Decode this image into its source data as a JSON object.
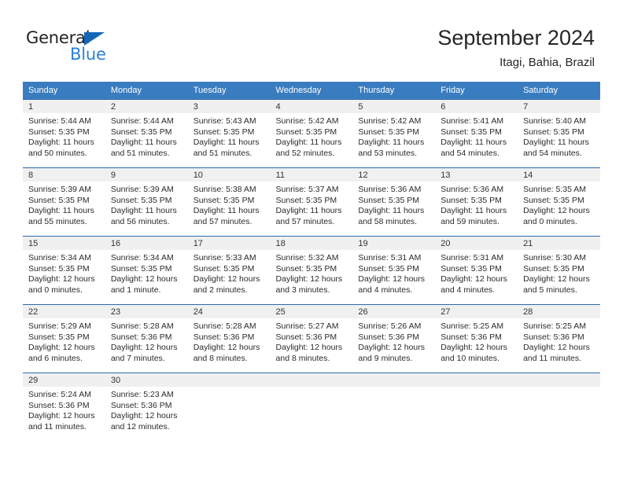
{
  "brand": {
    "name_dark": "General",
    "name_blue": "Blue",
    "color_dark": "#231f20",
    "color_blue": "#2a81d4",
    "triangle_color": "#1565b8"
  },
  "header": {
    "title": "September 2024",
    "subtitle": "Itagi, Bahia, Brazil"
  },
  "theme": {
    "header_bg": "#3a7cc0",
    "row_divider": "#2c6cb0",
    "daynum_bg": "#f0f0f0"
  },
  "calendar": {
    "weekday_headers": [
      "Sunday",
      "Monday",
      "Tuesday",
      "Wednesday",
      "Thursday",
      "Friday",
      "Saturday"
    ],
    "weeks": [
      [
        {
          "day": "1",
          "sunrise": "Sunrise: 5:44 AM",
          "sunset": "Sunset: 5:35 PM",
          "daylight_1": "Daylight: 11 hours",
          "daylight_2": "and 50 minutes."
        },
        {
          "day": "2",
          "sunrise": "Sunrise: 5:44 AM",
          "sunset": "Sunset: 5:35 PM",
          "daylight_1": "Daylight: 11 hours",
          "daylight_2": "and 51 minutes."
        },
        {
          "day": "3",
          "sunrise": "Sunrise: 5:43 AM",
          "sunset": "Sunset: 5:35 PM",
          "daylight_1": "Daylight: 11 hours",
          "daylight_2": "and 51 minutes."
        },
        {
          "day": "4",
          "sunrise": "Sunrise: 5:42 AM",
          "sunset": "Sunset: 5:35 PM",
          "daylight_1": "Daylight: 11 hours",
          "daylight_2": "and 52 minutes."
        },
        {
          "day": "5",
          "sunrise": "Sunrise: 5:42 AM",
          "sunset": "Sunset: 5:35 PM",
          "daylight_1": "Daylight: 11 hours",
          "daylight_2": "and 53 minutes."
        },
        {
          "day": "6",
          "sunrise": "Sunrise: 5:41 AM",
          "sunset": "Sunset: 5:35 PM",
          "daylight_1": "Daylight: 11 hours",
          "daylight_2": "and 54 minutes."
        },
        {
          "day": "7",
          "sunrise": "Sunrise: 5:40 AM",
          "sunset": "Sunset: 5:35 PM",
          "daylight_1": "Daylight: 11 hours",
          "daylight_2": "and 54 minutes."
        }
      ],
      [
        {
          "day": "8",
          "sunrise": "Sunrise: 5:39 AM",
          "sunset": "Sunset: 5:35 PM",
          "daylight_1": "Daylight: 11 hours",
          "daylight_2": "and 55 minutes."
        },
        {
          "day": "9",
          "sunrise": "Sunrise: 5:39 AM",
          "sunset": "Sunset: 5:35 PM",
          "daylight_1": "Daylight: 11 hours",
          "daylight_2": "and 56 minutes."
        },
        {
          "day": "10",
          "sunrise": "Sunrise: 5:38 AM",
          "sunset": "Sunset: 5:35 PM",
          "daylight_1": "Daylight: 11 hours",
          "daylight_2": "and 57 minutes."
        },
        {
          "day": "11",
          "sunrise": "Sunrise: 5:37 AM",
          "sunset": "Sunset: 5:35 PM",
          "daylight_1": "Daylight: 11 hours",
          "daylight_2": "and 57 minutes."
        },
        {
          "day": "12",
          "sunrise": "Sunrise: 5:36 AM",
          "sunset": "Sunset: 5:35 PM",
          "daylight_1": "Daylight: 11 hours",
          "daylight_2": "and 58 minutes."
        },
        {
          "day": "13",
          "sunrise": "Sunrise: 5:36 AM",
          "sunset": "Sunset: 5:35 PM",
          "daylight_1": "Daylight: 11 hours",
          "daylight_2": "and 59 minutes."
        },
        {
          "day": "14",
          "sunrise": "Sunrise: 5:35 AM",
          "sunset": "Sunset: 5:35 PM",
          "daylight_1": "Daylight: 12 hours",
          "daylight_2": "and 0 minutes."
        }
      ],
      [
        {
          "day": "15",
          "sunrise": "Sunrise: 5:34 AM",
          "sunset": "Sunset: 5:35 PM",
          "daylight_1": "Daylight: 12 hours",
          "daylight_2": "and 0 minutes."
        },
        {
          "day": "16",
          "sunrise": "Sunrise: 5:34 AM",
          "sunset": "Sunset: 5:35 PM",
          "daylight_1": "Daylight: 12 hours",
          "daylight_2": "and 1 minute."
        },
        {
          "day": "17",
          "sunrise": "Sunrise: 5:33 AM",
          "sunset": "Sunset: 5:35 PM",
          "daylight_1": "Daylight: 12 hours",
          "daylight_2": "and 2 minutes."
        },
        {
          "day": "18",
          "sunrise": "Sunrise: 5:32 AM",
          "sunset": "Sunset: 5:35 PM",
          "daylight_1": "Daylight: 12 hours",
          "daylight_2": "and 3 minutes."
        },
        {
          "day": "19",
          "sunrise": "Sunrise: 5:31 AM",
          "sunset": "Sunset: 5:35 PM",
          "daylight_1": "Daylight: 12 hours",
          "daylight_2": "and 4 minutes."
        },
        {
          "day": "20",
          "sunrise": "Sunrise: 5:31 AM",
          "sunset": "Sunset: 5:35 PM",
          "daylight_1": "Daylight: 12 hours",
          "daylight_2": "and 4 minutes."
        },
        {
          "day": "21",
          "sunrise": "Sunrise: 5:30 AM",
          "sunset": "Sunset: 5:35 PM",
          "daylight_1": "Daylight: 12 hours",
          "daylight_2": "and 5 minutes."
        }
      ],
      [
        {
          "day": "22",
          "sunrise": "Sunrise: 5:29 AM",
          "sunset": "Sunset: 5:35 PM",
          "daylight_1": "Daylight: 12 hours",
          "daylight_2": "and 6 minutes."
        },
        {
          "day": "23",
          "sunrise": "Sunrise: 5:28 AM",
          "sunset": "Sunset: 5:36 PM",
          "daylight_1": "Daylight: 12 hours",
          "daylight_2": "and 7 minutes."
        },
        {
          "day": "24",
          "sunrise": "Sunrise: 5:28 AM",
          "sunset": "Sunset: 5:36 PM",
          "daylight_1": "Daylight: 12 hours",
          "daylight_2": "and 8 minutes."
        },
        {
          "day": "25",
          "sunrise": "Sunrise: 5:27 AM",
          "sunset": "Sunset: 5:36 PM",
          "daylight_1": "Daylight: 12 hours",
          "daylight_2": "and 8 minutes."
        },
        {
          "day": "26",
          "sunrise": "Sunrise: 5:26 AM",
          "sunset": "Sunset: 5:36 PM",
          "daylight_1": "Daylight: 12 hours",
          "daylight_2": "and 9 minutes."
        },
        {
          "day": "27",
          "sunrise": "Sunrise: 5:25 AM",
          "sunset": "Sunset: 5:36 PM",
          "daylight_1": "Daylight: 12 hours",
          "daylight_2": "and 10 minutes."
        },
        {
          "day": "28",
          "sunrise": "Sunrise: 5:25 AM",
          "sunset": "Sunset: 5:36 PM",
          "daylight_1": "Daylight: 12 hours",
          "daylight_2": "and 11 minutes."
        }
      ],
      [
        {
          "day": "29",
          "sunrise": "Sunrise: 5:24 AM",
          "sunset": "Sunset: 5:36 PM",
          "daylight_1": "Daylight: 12 hours",
          "daylight_2": "and 11 minutes."
        },
        {
          "day": "30",
          "sunrise": "Sunrise: 5:23 AM",
          "sunset": "Sunset: 5:36 PM",
          "daylight_1": "Daylight: 12 hours",
          "daylight_2": "and 12 minutes."
        },
        {
          "day": "",
          "sunrise": "",
          "sunset": "",
          "daylight_1": "",
          "daylight_2": ""
        },
        {
          "day": "",
          "sunrise": "",
          "sunset": "",
          "daylight_1": "",
          "daylight_2": ""
        },
        {
          "day": "",
          "sunrise": "",
          "sunset": "",
          "daylight_1": "",
          "daylight_2": ""
        },
        {
          "day": "",
          "sunrise": "",
          "sunset": "",
          "daylight_1": "",
          "daylight_2": ""
        },
        {
          "day": "",
          "sunrise": "",
          "sunset": "",
          "daylight_1": "",
          "daylight_2": ""
        }
      ]
    ]
  }
}
